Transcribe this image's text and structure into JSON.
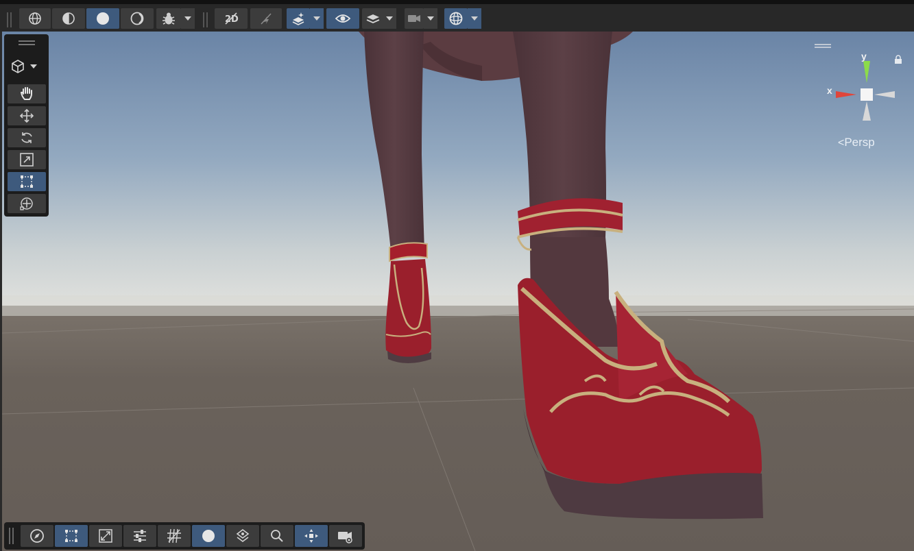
{
  "scene_view": {
    "gizmo": {
      "projection_label": "Persp",
      "axis_y": "y",
      "axis_x": "x"
    }
  },
  "top_toolbar": {
    "buttons": [
      {
        "name": "wireframe-draw-mode",
        "icon": "globe-wire-icon"
      },
      {
        "name": "shaded-wireframe-mode",
        "icon": "globe-half-icon"
      },
      {
        "name": "shaded-mode",
        "icon": "sphere-solid-icon",
        "active": true
      },
      {
        "name": "unlit-mode",
        "icon": "sphere-outline-icon"
      },
      {
        "name": "debug-draw-mode",
        "icon": "bug-icon"
      },
      {
        "name": "toggle-2d",
        "icon": "2d-slash-icon"
      },
      {
        "name": "toggle-lighting",
        "icon": "lighting-off-icon"
      },
      {
        "name": "effects",
        "icon": "layers-sparkle-icon",
        "active": true
      },
      {
        "name": "visibility",
        "icon": "eye-icon",
        "active": true
      },
      {
        "name": "layers",
        "icon": "stack-icon"
      },
      {
        "name": "camera",
        "icon": "camera-icon"
      },
      {
        "name": "gizmos",
        "icon": "gizmo-sphere-icon",
        "active": true
      }
    ]
  },
  "tools_panel": {
    "tools": [
      {
        "name": "view-tool",
        "icon": "hand-icon"
      },
      {
        "name": "move-tool",
        "icon": "move-arrows-icon"
      },
      {
        "name": "rotate-tool",
        "icon": "rotate-icon"
      },
      {
        "name": "scale-tool",
        "icon": "scale-icon"
      },
      {
        "name": "rect-tool",
        "icon": "rect-transform-icon",
        "active": true
      },
      {
        "name": "transform-tool",
        "icon": "transform-icon"
      }
    ]
  },
  "bottom_toolbar": {
    "buttons": [
      {
        "name": "compass",
        "icon": "compass-icon"
      },
      {
        "name": "rect-select",
        "icon": "rect-select-icon",
        "active": true
      },
      {
        "name": "snap-settings",
        "icon": "snap-icon"
      },
      {
        "name": "properties",
        "icon": "sliders-icon"
      },
      {
        "name": "grid",
        "icon": "grid-icon"
      },
      {
        "name": "shading",
        "icon": "circle-icon",
        "active": true
      },
      {
        "name": "layers-2",
        "icon": "layers-diamond-icon"
      },
      {
        "name": "search",
        "icon": "search-icon"
      },
      {
        "name": "pivot",
        "icon": "pivot-icon",
        "active": true
      },
      {
        "name": "camera-2",
        "icon": "camera-eye-icon"
      }
    ]
  },
  "colors": {
    "toolbar_bg": "#282828",
    "button_bg": "#3c3c3c",
    "button_active": "#3e5a7d",
    "sky_top": "#6e87a8",
    "ground": "#665f58",
    "shoe_red": "#9a1f2c",
    "trim_gold": "#c8b07e",
    "axis_x": "#e0453a",
    "axis_y": "#8cdc4a"
  }
}
